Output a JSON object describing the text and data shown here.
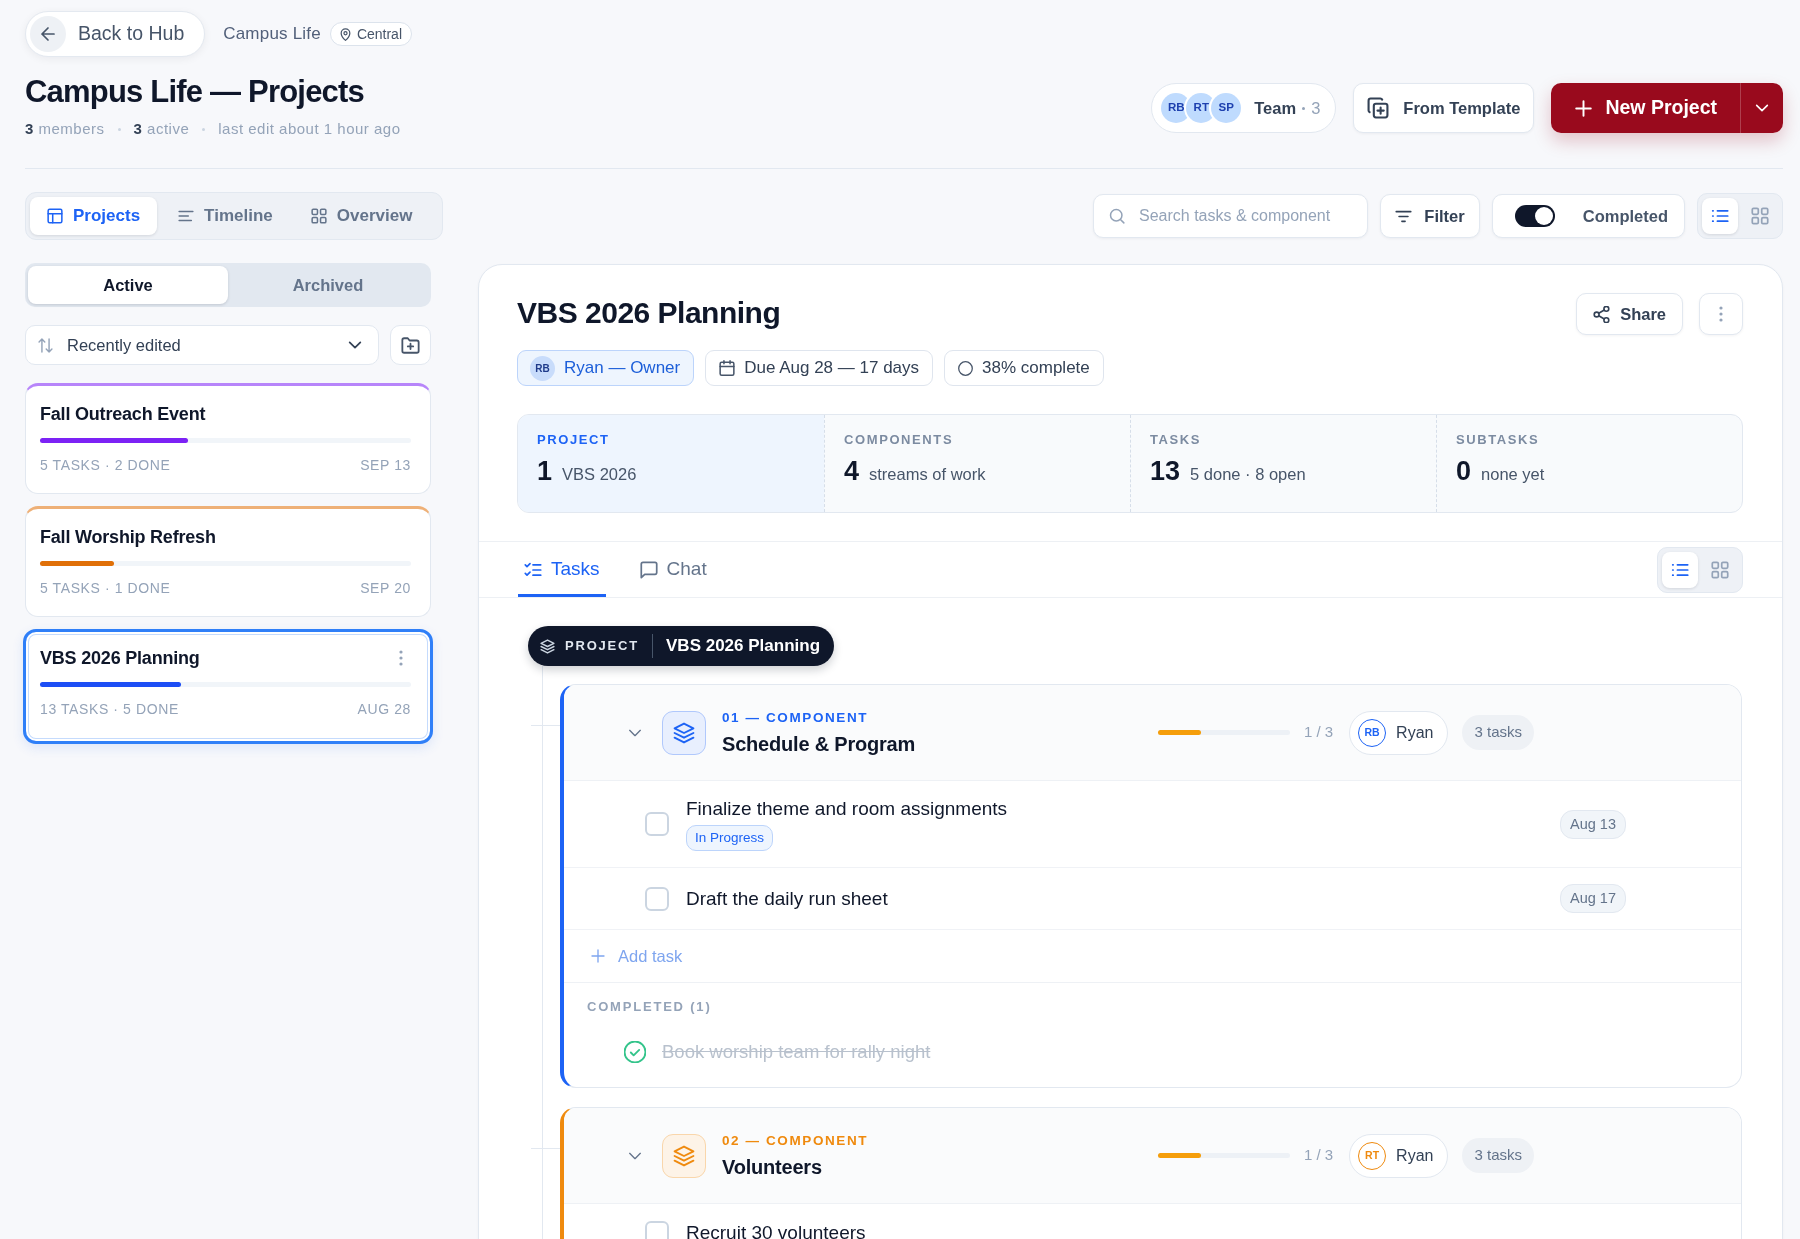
{
  "top_bar": {
    "back_button": "Back to Hub",
    "workspace": "Campus Life",
    "location": "Central"
  },
  "header": {
    "title": "Campus Life — Projects",
    "meta": [
      "**3** members",
      "**3** active",
      "last edit about 1 hour ago"
    ],
    "team": {
      "avatars": [
        "RB",
        "RT",
        "SP"
      ],
      "label": "Team",
      "count": "3"
    },
    "template_button": "From Template",
    "new_button": "New Project"
  },
  "view_tabs": [
    {
      "kind": "board",
      "label": "Projects",
      "selected": true
    },
    {
      "kind": "timeline",
      "label": "Timeline",
      "selected": false
    },
    {
      "kind": "grid",
      "label": "Overview",
      "selected": false
    }
  ],
  "toolbar": {
    "search": {
      "placeholder": "Search tasks & component"
    },
    "filter": "Filter",
    "completed_toggle": {
      "label": "Completed",
      "on": true
    },
    "layouts": [
      {
        "kind": "list",
        "selected": true
      },
      {
        "kind": "grid",
        "selected": false
      }
    ]
  },
  "sidebar": {
    "status_tabs": [
      {
        "label": "Active",
        "selected": true
      },
      {
        "label": "Archived",
        "selected": false
      }
    ],
    "sort": {
      "value": "Recently edited"
    },
    "projects": [
      {
        "name": "Fall Outreach Event",
        "color": "#7c22f5",
        "level": 0.4,
        "summary": "5 TASKS · 2 DONE",
        "due": "SEP 13",
        "selected": false
      },
      {
        "name": "Fall Worship Refresh",
        "color": "#e07008",
        "level": 0.2,
        "summary": "5 TASKS · 1 DONE",
        "due": "SEP 20",
        "selected": false
      },
      {
        "name": "VBS 2026 Planning",
        "color": "#1d4ef5",
        "level": 0.38,
        "summary": "13 TASKS · 5 DONE",
        "due": "AUG 28",
        "selected": true
      }
    ]
  },
  "project": {
    "title": "VBS 2026 Planning",
    "share_button": "Share",
    "owner": {
      "initials": "RB",
      "label": "Ryan — Owner"
    },
    "due": "Due Aug 28 — 17 days",
    "progress": "38% complete",
    "stats": [
      {
        "label": "PROJECT",
        "value": "1",
        "detail": "VBS 2026",
        "selected": true
      },
      {
        "label": "COMPONENTS",
        "value": "4",
        "detail": "streams of work",
        "selected": false
      },
      {
        "label": "TASKS",
        "value": "13",
        "detail": "5 done · 8 open",
        "selected": false
      },
      {
        "label": "SUBTASKS",
        "value": "0",
        "detail": "none yet",
        "selected": false
      }
    ],
    "tabs": [
      {
        "kind": "tasks",
        "label": "Tasks",
        "selected": true
      },
      {
        "kind": "chat",
        "label": "Chat",
        "selected": false
      }
    ],
    "layouts": [
      {
        "kind": "list",
        "selected": true
      },
      {
        "kind": "grid",
        "selected": false
      }
    ],
    "tree": {
      "root_tag": "PROJECT",
      "root_label": "VBS 2026 Planning",
      "components": [
        {
          "label": "01 — COMPONENT",
          "name": "Schedule & Program",
          "color": "#1d63f5",
          "expanded": true,
          "level": 0.33,
          "progress": "1 / 3",
          "assignee": {
            "initials": "RB",
            "name": "Ryan"
          },
          "task_count": "3 tasks",
          "tasks": [
            {
              "title": "Finalize theme and room assignments",
              "status": "In Progress",
              "due": "Aug 13",
              "checked": false
            },
            {
              "title": "Draft the daily run sheet",
              "due": "Aug 17",
              "checked": false
            }
          ],
          "add_task": "Add task",
          "completed_label": "COMPLETED (1)",
          "completed": [
            {
              "title": "Book worship team for rally night",
              "checked": true
            }
          ]
        },
        {
          "label": "02 — COMPONENT",
          "name": "Volunteers",
          "color": "#ef8a0e",
          "expanded": true,
          "level": 0.33,
          "progress": "1 / 3",
          "assignee": {
            "initials": "RT",
            "name": "Ryan"
          },
          "task_count": "3 tasks",
          "tasks": [
            {
              "title": "Recruit 30 volunteers",
              "checked": false
            }
          ]
        }
      ]
    }
  }
}
